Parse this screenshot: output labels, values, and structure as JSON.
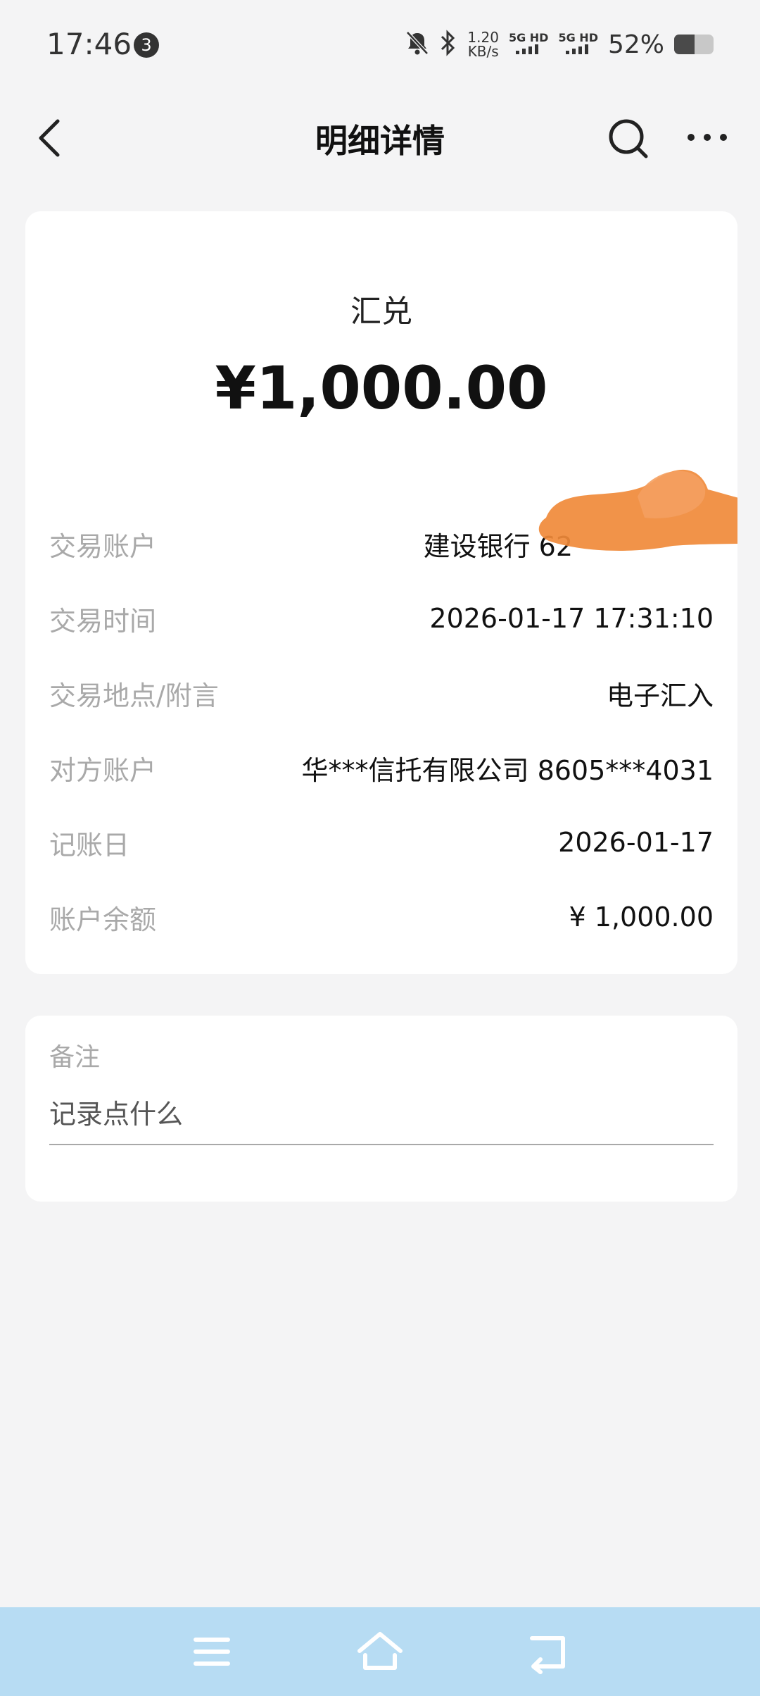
{
  "status_bar": {
    "time": "17:46",
    "notification_count": "3",
    "net_speed_value": "1.20",
    "net_speed_unit": "KB/s",
    "signal1_label": "5G HD",
    "signal2_label": "5G HD",
    "battery": "52%",
    "battery_level": 0.52,
    "icons": [
      "mute-icon",
      "bluetooth-icon",
      "signal-icon",
      "battery-icon"
    ]
  },
  "header": {
    "title": "明细详情",
    "icons": [
      "back-icon",
      "search-icon",
      "more-icon"
    ]
  },
  "transaction": {
    "type": "汇兑",
    "amount": "¥1,000.00",
    "rows": [
      {
        "label": "交易账户",
        "value": "建设银行 62"
      },
      {
        "label": "交易时间",
        "value": "2026-01-17 17:31:10"
      },
      {
        "label": "交易地点/附言",
        "value": "电子汇入"
      },
      {
        "label": "对方账户",
        "value": "华***信托有限公司 8605***4031"
      },
      {
        "label": "记账日",
        "value": "2026-01-17"
      },
      {
        "label": "账户余额",
        "value": "¥ 1,000.00"
      }
    ]
  },
  "note": {
    "label": "备注",
    "placeholder": "记录点什么"
  },
  "nav": {
    "icons": [
      "menu-icon",
      "home-icon",
      "back-nav-icon"
    ]
  },
  "colors": {
    "background": "#f4f4f5",
    "card": "#ffffff",
    "label_gray": "#a9a9a9",
    "nav_bar": "#b7dcf3",
    "redaction": "#f08a3a"
  }
}
